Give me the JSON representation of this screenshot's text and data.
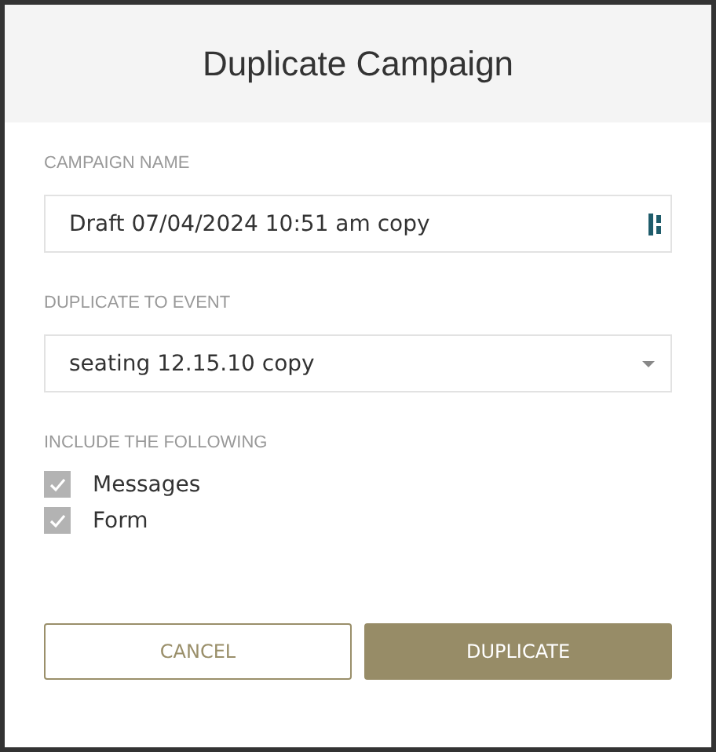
{
  "dialog": {
    "title": "Duplicate Campaign"
  },
  "campaign_name": {
    "label": "CAMPAIGN NAME",
    "value": "Draft 07/04/2024 10:51 am copy"
  },
  "event": {
    "label": "DUPLICATE TO EVENT",
    "value": "seating 12.15.10 copy"
  },
  "include": {
    "label": "INCLUDE THE FOLLOWING",
    "options": [
      {
        "label": "Messages",
        "checked": true
      },
      {
        "label": "Form",
        "checked": true
      }
    ]
  },
  "buttons": [
    {
      "label": "CANCEL",
      "kind": "secondary"
    },
    {
      "label": "DUPLICATE",
      "kind": "primary"
    }
  ]
}
